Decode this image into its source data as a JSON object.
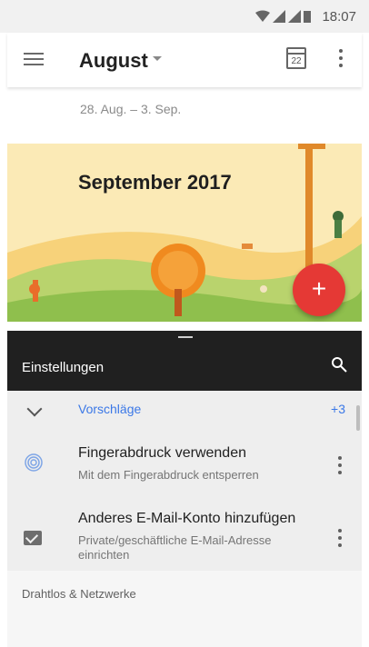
{
  "status_bar": {
    "time": "18:07"
  },
  "app_bar": {
    "title": "August",
    "calendar_day": "22"
  },
  "week_range": "28. Aug. – 3. Sep.",
  "banner": {
    "title": "September 2017",
    "fab_label": "+"
  },
  "settings": {
    "header_title": "Einstellungen",
    "suggestions": {
      "label": "Vorschläge",
      "count": "+3"
    },
    "items": [
      {
        "title": "Fingerabdruck verwenden",
        "subtitle": "Mit dem Fingerabdruck entsperren",
        "icon": "fingerprint-icon"
      },
      {
        "title": "Anderes E-Mail-Konto hinzufügen",
        "subtitle_line1": "Private/geschäftliche E-Mail-Adresse",
        "subtitle_line2": "einrichten",
        "icon": "mail-icon"
      }
    ],
    "section_title": "Drahtlos & Netzwerke"
  },
  "colors": {
    "accent_blue": "#3b78e7",
    "fab_red": "#e53935",
    "dark_header": "#202020"
  }
}
